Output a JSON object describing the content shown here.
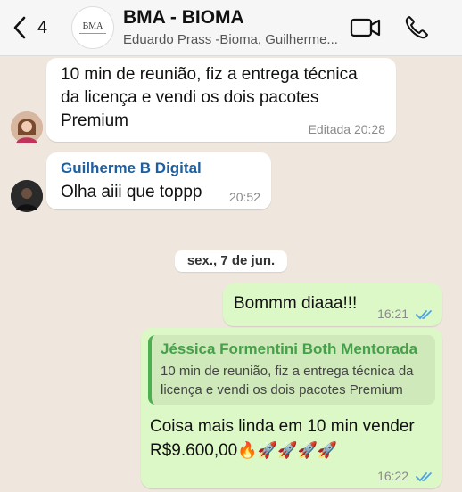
{
  "header": {
    "back_count": "4",
    "group_logo_text": "BMA",
    "title": "BMA - BIOMA",
    "subtitle": "Eduardo Prass -Bioma, Guilherme..."
  },
  "messages": [
    {
      "line1": "10 min de reunião, fiz a entrega técnica",
      "line2": "da licença  e vendi os dois pacotes",
      "line3": "Premium",
      "meta": "Editada 20:28"
    },
    {
      "sender": "Guilherme B Digital",
      "text": "Olha aiii que toppp",
      "time": "20:52"
    }
  ],
  "date_separator": "sex., 7 de jun.",
  "outgoing": [
    {
      "text": "Bommm diaaa!!!",
      "time": "16:21"
    },
    {
      "quoted_name": "Jéssica Formentini Both Mentorada",
      "quoted_line1": "10 min de reunião, fiz a entrega técnica da",
      "quoted_line2": "licença  e vendi os dois pacotes Premium",
      "line1": "Coisa mais linda em 10 min vender",
      "line2": "R$9.600,00",
      "emojis": "🔥🚀🚀🚀🚀",
      "time": "16:22"
    }
  ],
  "colors": {
    "accent_blue": "#1d5fa0",
    "tick_blue": "#4fa3e0",
    "outgoing_bg": "#dcf8c6",
    "quote_green": "#45a049"
  }
}
